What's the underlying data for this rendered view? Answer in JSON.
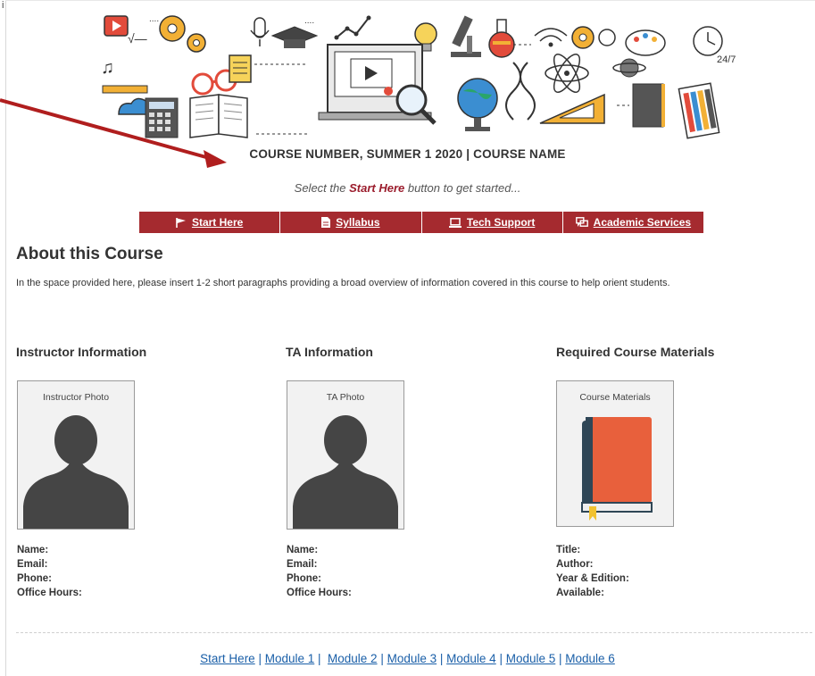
{
  "corner_mark": "i",
  "banner": {
    "icons": [
      "play-icon",
      "gear-icon",
      "microphone-icon",
      "graduation-cap-icon",
      "chart-icon",
      "lightbulb-icon",
      "microscope-icon",
      "flask-icon",
      "wifi-icon",
      "atom-icon",
      "palette-icon",
      "clock-icon",
      "music-icon",
      "calculator-icon",
      "book-icon",
      "laptop-icon",
      "magnifier-icon",
      "globe-icon",
      "dna-icon",
      "ruler-icon",
      "planet-icon",
      "notebook-icon",
      "pencils-icon"
    ],
    "clock_label": "24/7"
  },
  "course_title": "COURSE NUMBER, SUMMER 1 2020 | COURSE NAME",
  "prompt": {
    "before": "Select the ",
    "highlight": "Start Here",
    "after": " button to get started..."
  },
  "navbar": {
    "items": [
      {
        "label": "Start Here",
        "icon": "flag-icon"
      },
      {
        "label": "Syllabus",
        "icon": "document-icon"
      },
      {
        "label": "Tech Support",
        "icon": "laptop-icon"
      },
      {
        "label": "Academic Services",
        "icon": "chat-icon"
      }
    ]
  },
  "about": {
    "heading": "About this Course",
    "text": "In the space provided here, please insert 1-2 short paragraphs providing a broad overview of information covered in this course to help orient students."
  },
  "instructor": {
    "heading": "Instructor Information",
    "photo_caption": "Instructor Photo",
    "fields": [
      "Name:",
      "Email:",
      "Phone:",
      "Office Hours:"
    ]
  },
  "ta": {
    "heading": "TA Information",
    "photo_caption": "TA Photo",
    "fields": [
      "Name:",
      "Email:",
      "Phone:",
      "Office Hours:"
    ]
  },
  "materials": {
    "heading": "Required Course Materials",
    "photo_caption": "Course Materials",
    "fields": [
      "Title:",
      "Author:",
      "Year & Edition:",
      "Available:"
    ]
  },
  "footer_nav": {
    "links": [
      "Start Here",
      "Module 1",
      "Module 2",
      "Module 3",
      "Module 4",
      "Module 5",
      "Module 6"
    ]
  },
  "colors": {
    "accent": "#a52a2f",
    "link": "#1a5fa8",
    "arrow": "#b01e1e"
  }
}
